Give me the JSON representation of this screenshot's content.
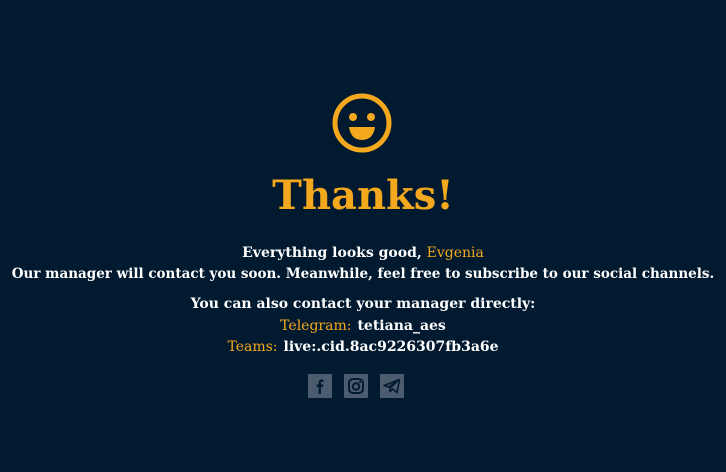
{
  "title": "Thanks!",
  "message": {
    "greeting_prefix": "Everything looks good,",
    "user_name": "Evgenia",
    "subline": "Our manager will contact you soon. Meanwhile, feel free to subscribe to our social channels.",
    "contact_intro": "You can also contact your manager directly:"
  },
  "contacts": {
    "telegram_label": "Telegram:",
    "telegram_value": "tetiana_aes",
    "teams_label": "Teams:",
    "teams_value": "live:.cid.8ac9226307fb3a6e"
  },
  "social": [
    "facebook-icon",
    "instagram-icon",
    "telegram-icon"
  ],
  "colors": {
    "background": "#021a2f",
    "accent": "#f4a81d",
    "icon_bg": "#4a5c6d"
  }
}
